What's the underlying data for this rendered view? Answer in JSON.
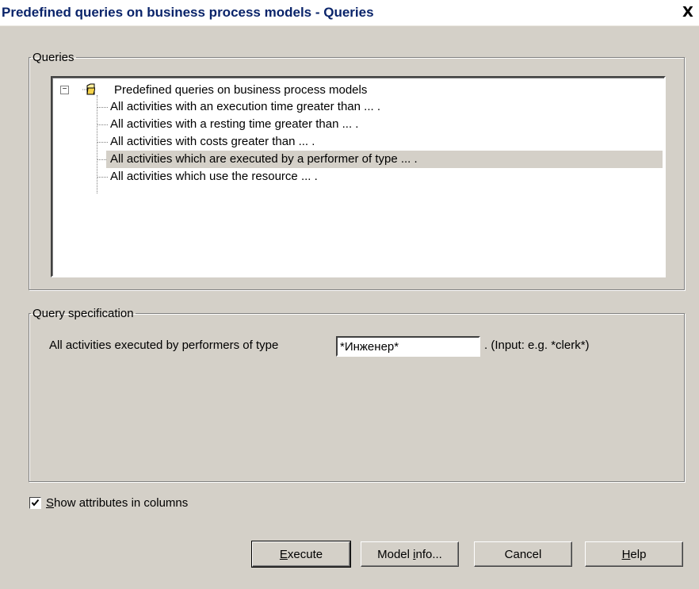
{
  "window": {
    "title": "Predefined queries on business process models - Queries",
    "close_label": "X"
  },
  "queries_group": {
    "label": "Queries",
    "root": {
      "label": "Predefined queries on business process models",
      "expander": "−",
      "icon": "folder-open-icon"
    },
    "items": [
      {
        "label": "All activities with an execution time greater than ... ."
      },
      {
        "label": "All activities with a resting time greater than ... ."
      },
      {
        "label": "All activities with costs greater than ... ."
      },
      {
        "label": "All activities which are executed by a performer of type ... .",
        "selected": true
      },
      {
        "label": "All activities which use the resource ... ."
      }
    ]
  },
  "spec_group": {
    "label": "Query specification",
    "prompt": "All activities executed by performers of type",
    "input_value": "*Инженер*",
    "hint": ". (Input: e.g. *clerk*)"
  },
  "show_attributes": {
    "checked": true,
    "accel": "S",
    "label_rest": "how attributes in columns"
  },
  "buttons": {
    "execute": {
      "accel": "E",
      "rest": "xecute"
    },
    "model_info": {
      "before": "Model ",
      "accel": "i",
      "rest": "nfo..."
    },
    "cancel": {
      "label": "Cancel"
    },
    "help": {
      "accel": "H",
      "rest": "elp"
    }
  },
  "colors": {
    "title_text": "#0a246a",
    "dialog_bg": "#d4d0c8",
    "selection_bg": "#d4d0c8"
  }
}
